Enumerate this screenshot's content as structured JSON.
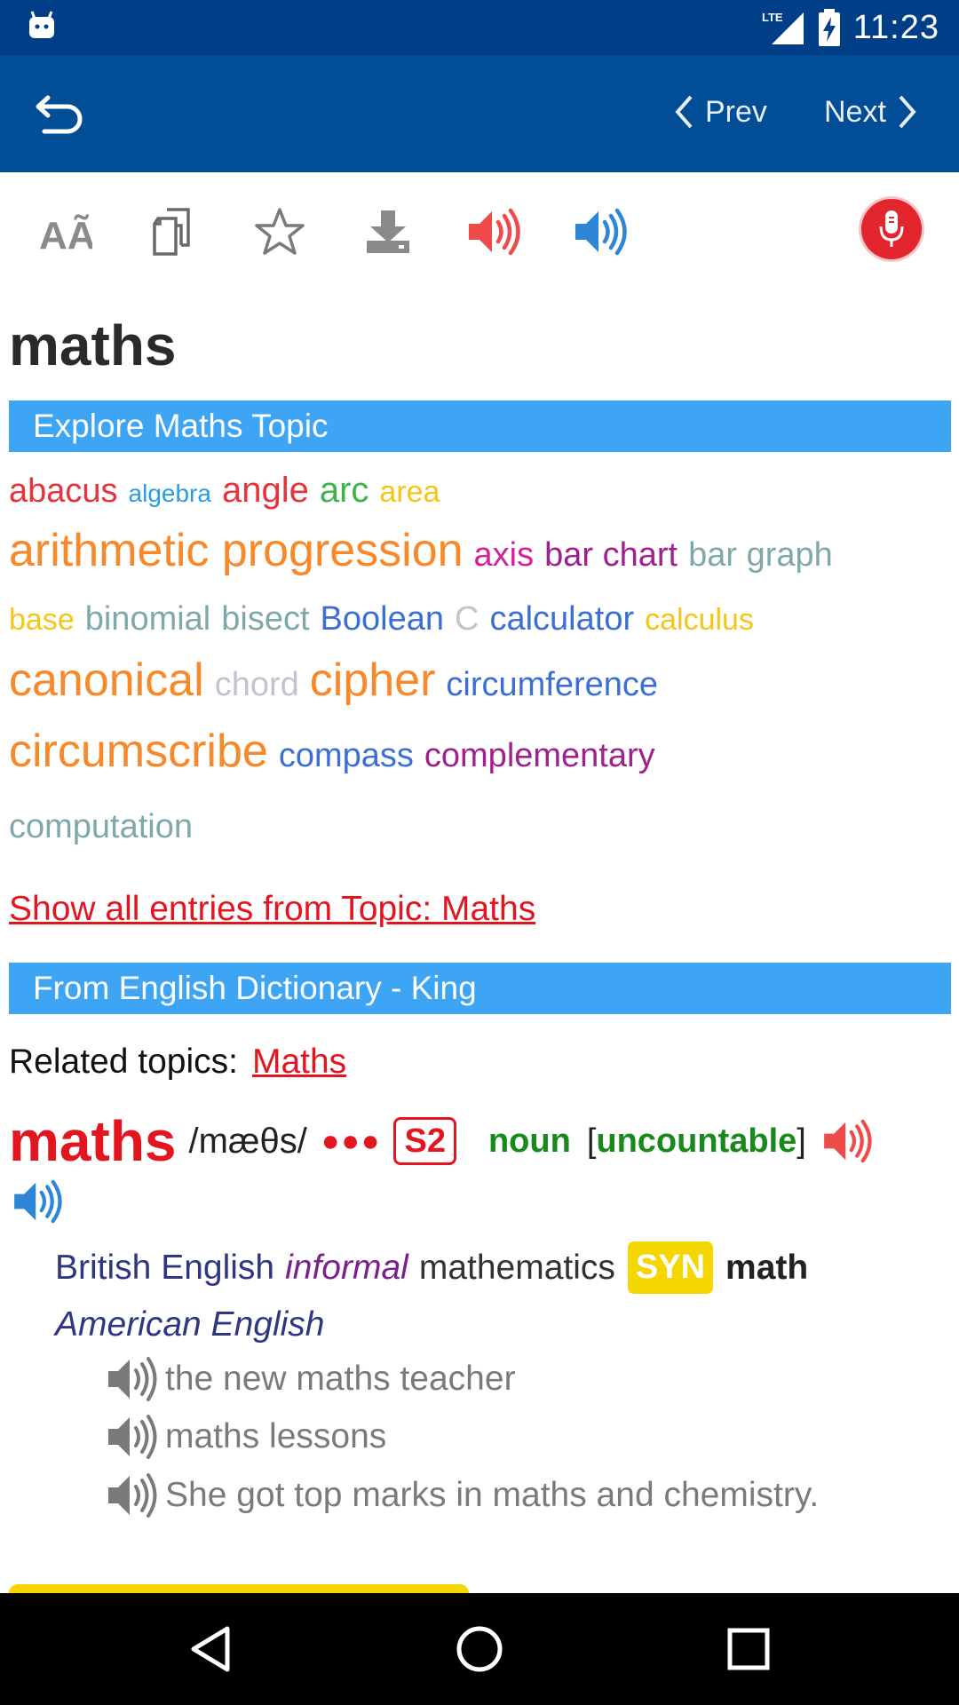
{
  "status_bar": {
    "time": "11:23",
    "network": "LTE"
  },
  "app_bar": {
    "prev_label": "Prev",
    "next_label": "Next"
  },
  "toolbar": {
    "icons": [
      "font-size-icon",
      "copy-icon",
      "star-icon",
      "download-icon",
      "speaker-uk-icon",
      "speaker-us-icon",
      "microphone-icon"
    ],
    "colors": {
      "uk": "#ef4b4b",
      "us": "#2f86d6",
      "mic": "#e3262e"
    }
  },
  "headword": "maths",
  "explore_section": {
    "title": "Explore Maths Topic",
    "topics": [
      {
        "word": "abacus",
        "color": "#e8323d",
        "size": 38
      },
      {
        "word": "algebra",
        "color": "#2b9be3",
        "size": 28
      },
      {
        "word": "angle",
        "color": "#e8323d",
        "size": 40
      },
      {
        "word": "arc",
        "color": "#39b54a",
        "size": 40
      },
      {
        "word": "area",
        "color": "#f5c518",
        "size": 34
      },
      {
        "word": "arithmetic progression",
        "color": "#f7892a",
        "size": 52
      },
      {
        "word": "axis",
        "color": "#d4209b",
        "size": 38
      },
      {
        "word": "bar chart",
        "color": "#a0208e",
        "size": 38
      },
      {
        "word": "bar graph",
        "color": "#7fa8a8",
        "size": 38
      },
      {
        "word": "base",
        "color": "#f5c518",
        "size": 34
      },
      {
        "word": "binomial",
        "color": "#7fa8a8",
        "size": 38
      },
      {
        "word": "bisect",
        "color": "#7fa8a8",
        "size": 38
      },
      {
        "word": "Boolean",
        "color": "#3b6fd6",
        "size": 38
      },
      {
        "word": "C",
        "color": "#c0c4cc",
        "size": 38
      },
      {
        "word": "calculator",
        "color": "#3b6fd6",
        "size": 38
      },
      {
        "word": "calculus",
        "color": "#f5c518",
        "size": 34
      },
      {
        "word": "canonical",
        "color": "#f7892a",
        "size": 52
      },
      {
        "word": "chord",
        "color": "#c0c4cc",
        "size": 38
      },
      {
        "word": "cipher",
        "color": "#f7892a",
        "size": 52
      },
      {
        "word": "circumference",
        "color": "#3b6fd6",
        "size": 38
      },
      {
        "word": "circumscribe",
        "color": "#f7892a",
        "size": 52
      },
      {
        "word": "compass",
        "color": "#3b6fd6",
        "size": 38
      },
      {
        "word": "complementary",
        "color": "#a0208e",
        "size": 38
      },
      {
        "word": "computation",
        "color": "#7fa8a8",
        "size": 38
      }
    ],
    "show_all": "Show all entries from Topic: Maths"
  },
  "dictionary_section": {
    "title": "From English Dictionary - King",
    "related_label": "Related topics:",
    "related_link": "Maths",
    "entry": {
      "word": "maths",
      "pronunciation": "/mæθs/",
      "frequency_dots": "●●●",
      "level": "S2",
      "part_of_speech": "noun",
      "grammar_open": "[",
      "grammar": "uncountable",
      "grammar_close": "]",
      "region": "British English",
      "register": "informal",
      "meaning": "mathematics",
      "syn_label": "SYN",
      "synonym": "math",
      "synonym_region": "American English",
      "examples": [
        "the new maths teacher",
        "maths lessons",
        "She got top marks in maths and chemistry."
      ]
    }
  }
}
